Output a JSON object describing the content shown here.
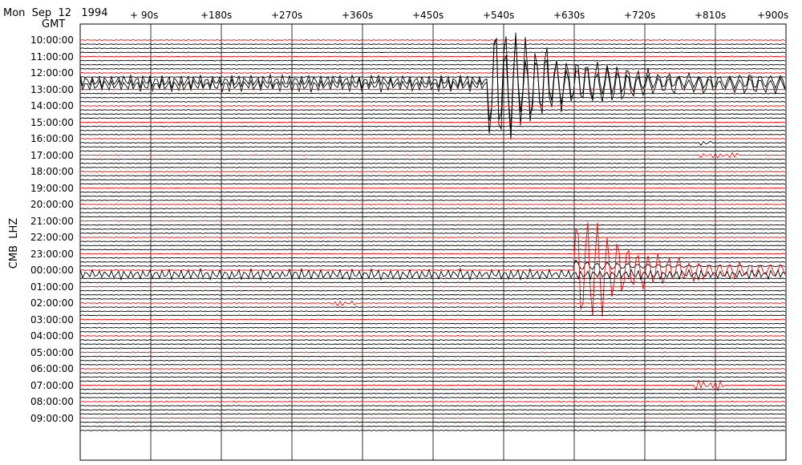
{
  "header": {
    "date_text": "Mon  Sep  12   1994",
    "gmt_label": "GMT"
  },
  "station_label": "CMB  LHZ",
  "colors": {
    "trace_black": "#000000",
    "trace_red": "#ff0000",
    "background": "#ffffff"
  },
  "chart_data": {
    "type": "line",
    "title": "",
    "xlabel": "",
    "ylabel": "CMB  LHZ",
    "x_unit": "seconds",
    "xlim": [
      0,
      900
    ],
    "x_ticks": [
      {
        "value": 90,
        "label": "+ 90s"
      },
      {
        "value": 180,
        "label": "+180s"
      },
      {
        "value": 270,
        "label": "+270s"
      },
      {
        "value": 360,
        "label": "+360s"
      },
      {
        "value": 450,
        "label": "+450s"
      },
      {
        "value": 540,
        "label": "+540s"
      },
      {
        "value": 630,
        "label": "+630s"
      },
      {
        "value": 720,
        "label": "+720s"
      },
      {
        "value": 810,
        "label": "+810s"
      },
      {
        "value": 900,
        "label": "+900s"
      }
    ],
    "hour_labels": [
      "10:00:00",
      "11:00:00",
      "12:00:00",
      "13:00:00",
      "14:00:00",
      "15:00:00",
      "16:00:00",
      "17:00:00",
      "18:00:00",
      "19:00:00",
      "20:00:00",
      "21:00:00",
      "22:00:00",
      "23:00:00",
      "00:00:00",
      "01:00:00",
      "02:00:00",
      "03:00:00",
      "04:00:00",
      "05:00:00",
      "06:00:00",
      "07:00:00",
      "08:00:00",
      "09:00:00"
    ],
    "traces_per_hour": 4,
    "red_trace_indices": [
      0,
      4,
      8,
      12,
      16,
      20,
      24,
      28,
      32,
      36,
      40,
      44,
      48,
      52,
      56,
      60,
      64,
      68,
      72,
      76,
      80,
      84,
      88,
      92
    ],
    "events": [
      {
        "trace": 10,
        "x_start": 0,
        "x_end": 520,
        "kind": "surface_wave",
        "amplitude": "large"
      },
      {
        "trace": 11,
        "x_start": 0,
        "x_end": 520,
        "kind": "surface_wave",
        "amplitude": "large"
      },
      {
        "trace": 10,
        "x_start": 520,
        "x_end": 900,
        "kind": "main_shock",
        "amplitude": "very_large"
      },
      {
        "trace": 11,
        "x_start": 520,
        "x_end": 900,
        "kind": "main_shock",
        "amplitude": "very_large"
      },
      {
        "trace": 57,
        "x_start": 0,
        "x_end": 900,
        "kind": "coda",
        "amplitude": "medium"
      },
      {
        "trace": 56,
        "x_start": 630,
        "x_end": 900,
        "kind": "aftershock",
        "amplitude": "very_large"
      },
      {
        "trace": 55,
        "x_start": 630,
        "x_end": 900,
        "kind": "aftershock",
        "amplitude": "large"
      },
      {
        "trace": 64,
        "x_start": 320,
        "x_end": 350,
        "kind": "small_event",
        "amplitude": "small"
      },
      {
        "trace": 84,
        "x_start": 785,
        "x_end": 820,
        "kind": "small_event",
        "amplitude": "medium"
      },
      {
        "trace": 28,
        "x_start": 790,
        "x_end": 840,
        "kind": "small_event",
        "amplitude": "small"
      },
      {
        "trace": 25,
        "x_start": 790,
        "x_end": 805,
        "kind": "small_event",
        "amplitude": "small"
      }
    ]
  }
}
